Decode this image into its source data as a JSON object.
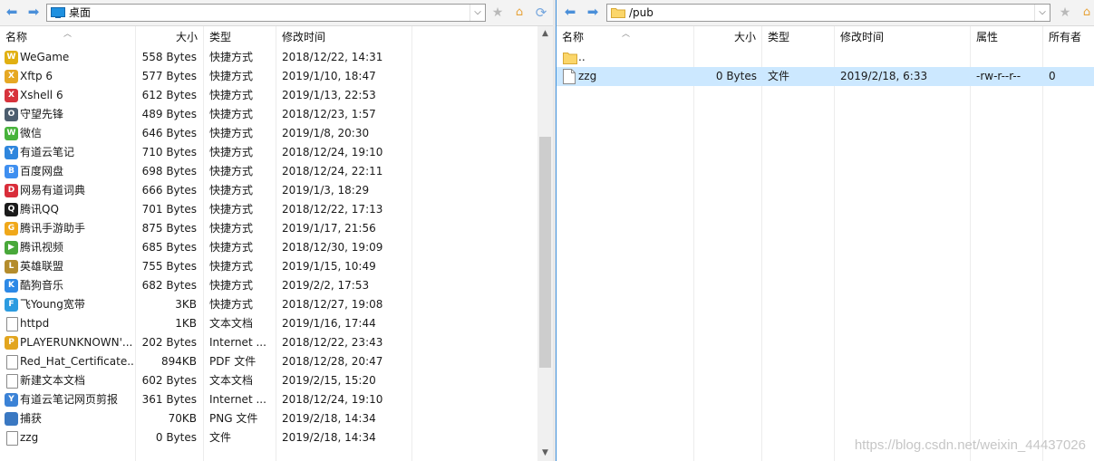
{
  "left_pane": {
    "path": "桌面",
    "columns": {
      "name": "名称",
      "size": "大小",
      "type": "类型",
      "modified": "修改时间"
    },
    "scroll_position": 0.55,
    "files": [
      {
        "name": "WeGame",
        "size": "558 Bytes",
        "type": "快捷方式",
        "modified": "2018/12/22, 14:31",
        "icon": "wegame-icon",
        "color": "#e1b012",
        "glyph": "W"
      },
      {
        "name": "Xftp 6",
        "size": "577 Bytes",
        "type": "快捷方式",
        "modified": "2019/1/10, 18:47",
        "icon": "xftp-icon",
        "color": "#e6a824",
        "glyph": "X"
      },
      {
        "name": "Xshell 6",
        "size": "612 Bytes",
        "type": "快捷方式",
        "modified": "2019/1/13, 22:53",
        "icon": "xshell-icon",
        "color": "#d7333c",
        "glyph": "X"
      },
      {
        "name": "守望先锋",
        "size": "489 Bytes",
        "type": "快捷方式",
        "modified": "2018/12/23, 1:57",
        "icon": "overwatch-icon",
        "color": "#4d5e6f",
        "glyph": "O"
      },
      {
        "name": "微信",
        "size": "646 Bytes",
        "type": "快捷方式",
        "modified": "2019/1/8, 20:30",
        "icon": "wechat-icon",
        "color": "#48b33c",
        "glyph": "W"
      },
      {
        "name": "有道云笔记",
        "size": "710 Bytes",
        "type": "快捷方式",
        "modified": "2018/12/24, 19:10",
        "icon": "youdao-note-icon",
        "color": "#2f86dd",
        "glyph": "Y"
      },
      {
        "name": "百度网盘",
        "size": "698 Bytes",
        "type": "快捷方式",
        "modified": "2018/12/24, 22:11",
        "icon": "baidu-pan-icon",
        "color": "#3f8ff0",
        "glyph": "B"
      },
      {
        "name": "网易有道词典",
        "size": "666 Bytes",
        "type": "快捷方式",
        "modified": "2019/1/3, 18:29",
        "icon": "youdao-dict-icon",
        "color": "#d92d3a",
        "glyph": "D"
      },
      {
        "name": "腾讯QQ",
        "size": "701 Bytes",
        "type": "快捷方式",
        "modified": "2018/12/22, 17:13",
        "icon": "qq-icon",
        "color": "#1b1b1b",
        "glyph": "Q"
      },
      {
        "name": "腾讯手游助手",
        "size": "875 Bytes",
        "type": "快捷方式",
        "modified": "2019/1/17, 21:56",
        "icon": "tencent-game-helper-icon",
        "color": "#f0a81a",
        "glyph": "G"
      },
      {
        "name": "腾讯视频",
        "size": "685 Bytes",
        "type": "快捷方式",
        "modified": "2018/12/30, 19:09",
        "icon": "tencent-video-icon",
        "color": "#49a83a",
        "glyph": "▶"
      },
      {
        "name": "英雄联盟",
        "size": "755 Bytes",
        "type": "快捷方式",
        "modified": "2019/1/15, 10:49",
        "icon": "league-icon",
        "color": "#b48c2c",
        "glyph": "L"
      },
      {
        "name": "酷狗音乐",
        "size": "682 Bytes",
        "type": "快捷方式",
        "modified": "2019/2/2, 17:53",
        "icon": "kugou-icon",
        "color": "#2d89e6",
        "glyph": "K"
      },
      {
        "name": "飞Young宽带",
        "size": "3KB",
        "type": "快捷方式",
        "modified": "2018/12/27, 19:08",
        "icon": "feiyoung-icon",
        "color": "#2c9be0",
        "glyph": "F"
      },
      {
        "name": "httpd",
        "size": "1KB",
        "type": "文本文档",
        "modified": "2019/1/16, 17:44",
        "icon": "text-file-icon",
        "color": "#ffffff",
        "glyph": ""
      },
      {
        "name": "PLAYERUNKNOWN'...",
        "size": "202 Bytes",
        "type": "Internet ...",
        "modified": "2018/12/22, 23:43",
        "icon": "pubg-icon",
        "color": "#e2a51e",
        "glyph": "P"
      },
      {
        "name": "Red_Hat_Certificate...",
        "size": "894KB",
        "type": "PDF 文件",
        "modified": "2018/12/28, 20:47",
        "icon": "pdf-file-icon",
        "color": "#ffffff",
        "glyph": ""
      },
      {
        "name": "新建文本文档",
        "size": "602 Bytes",
        "type": "文本文档",
        "modified": "2019/2/15, 15:20",
        "icon": "text-file-icon",
        "color": "#ffffff",
        "glyph": ""
      },
      {
        "name": "有道云笔记网页剪报",
        "size": "361 Bytes",
        "type": "Internet ...",
        "modified": "2018/12/24, 19:10",
        "icon": "internet-shortcut-icon",
        "color": "#3b82d6",
        "glyph": "Y"
      },
      {
        "name": "捕获",
        "size": "70KB",
        "type": "PNG 文件",
        "modified": "2019/2/18, 14:34",
        "icon": "png-file-icon",
        "color": "#3a78c2",
        "glyph": ""
      },
      {
        "name": "zzg",
        "size": "0 Bytes",
        "type": "文件",
        "modified": "2019/2/18, 14:34",
        "icon": "file-icon",
        "color": "#ffffff",
        "glyph": ""
      }
    ]
  },
  "right_pane": {
    "path": "/pub",
    "columns": {
      "name": "名称",
      "size": "大小",
      "type": "类型",
      "modified": "修改时间",
      "attributes": "属性",
      "owner": "所有者"
    },
    "parent": "..",
    "files": [
      {
        "name": "zzg",
        "size": "0 Bytes",
        "type": "文件",
        "modified": "2019/2/18, 6:33",
        "attributes": "-rw-r--r--",
        "owner": "0",
        "selected": true
      }
    ]
  },
  "watermark": "https://blog.csdn.net/weixin_44437026"
}
